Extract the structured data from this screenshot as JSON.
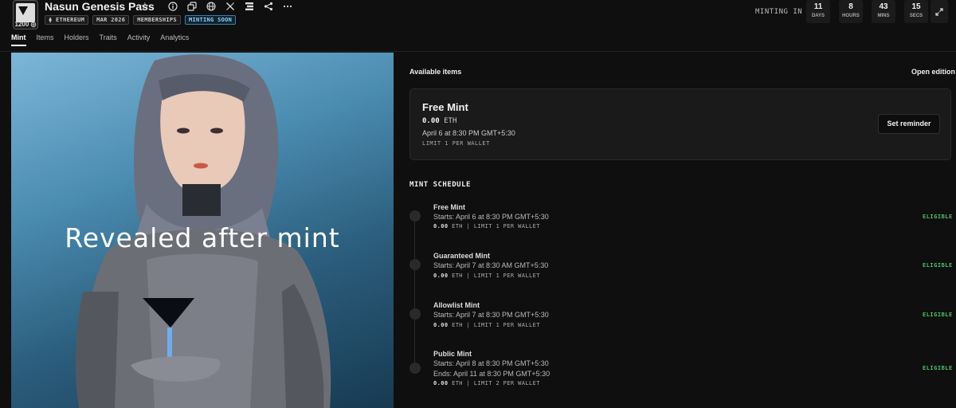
{
  "collection": {
    "title": "Nasun Genesis Pass",
    "logo_count": "1200",
    "tags": [
      "⧫ ETHEREUM",
      "MAR 2026",
      "MEMBERSHIPS",
      "MINTING SOON"
    ]
  },
  "header_icons": [
    "info-icon",
    "copy-icon",
    "globe-icon",
    "x-logo-icon",
    "stack-icon",
    "share-icon",
    "more-icon"
  ],
  "tabs": [
    "Mint",
    "Items",
    "Holders",
    "Traits",
    "Activity",
    "Analytics"
  ],
  "countdown": {
    "label": "MINTING IN",
    "units": [
      {
        "value": "11",
        "label": "DAYS"
      },
      {
        "value": "8",
        "label": "HOURS"
      },
      {
        "value": "43",
        "label": "MINS"
      },
      {
        "value": "15",
        "label": "SECS"
      }
    ]
  },
  "artwork": {
    "overlay_text": "Revealed after mint"
  },
  "available": {
    "label": "Available items",
    "edition": "Open edition"
  },
  "current_mint": {
    "title": "Free Mint",
    "price": "0.00",
    "currency": "ETH",
    "date": "April 6 at 8:30 PM GMT+5:30",
    "limit": "LIMIT 1 PER WALLET",
    "button": "Set reminder"
  },
  "schedule": {
    "title": "MINT SCHEDULE",
    "phases": [
      {
        "name": "Free Mint",
        "start": "Starts: April 6 at 8:30 PM GMT+5:30",
        "end": "",
        "price": "0.00",
        "rest": " ETH | LIMIT 1 PER WALLET",
        "status": "ELIGIBLE"
      },
      {
        "name": "Guaranteed Mint",
        "start": "Starts: April 7 at 8:30 AM GMT+5:30",
        "end": "",
        "price": "0.00",
        "rest": " ETH | LIMIT 1 PER WALLET",
        "status": "ELIGIBLE"
      },
      {
        "name": "Allowlist Mint",
        "start": "Starts: April 7 at 8:30 PM GMT+5:30",
        "end": "",
        "price": "0.00",
        "rest": " ETH | LIMIT 1 PER WALLET",
        "status": "ELIGIBLE"
      },
      {
        "name": "Public Mint",
        "start": "Starts: April 8 at 8:30 PM GMT+5:30",
        "end": "Ends: April 11 at 8:30 PM GMT+5:30",
        "price": "0.00",
        "rest": " ETH | LIMIT 2 PER WALLET",
        "status": "ELIGIBLE"
      }
    ]
  },
  "colors": {
    "background": "#0f0f0f",
    "eligible": "#4cc26e",
    "minting_soon": "#8fd0ff"
  }
}
